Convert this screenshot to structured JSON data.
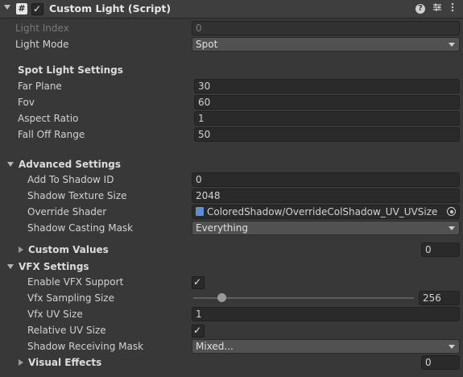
{
  "component": {
    "title": "Custom Light (Script)",
    "script_icon": "#",
    "enabled_check": "✓",
    "icons": [
      "help-icon",
      "presets-icon",
      "kebab-menu-icon"
    ]
  },
  "fields": {
    "light_index": {
      "label": "Light Index",
      "value": "0"
    },
    "light_mode": {
      "label": "Light Mode",
      "value": "Spot"
    }
  },
  "spot": {
    "header": "Spot Light Settings",
    "far_plane": {
      "label": "Far Plane",
      "value": "30"
    },
    "fov": {
      "label": "Fov",
      "value": "60"
    },
    "aspect_ratio": {
      "label": "Aspect Ratio",
      "value": "1"
    },
    "fall_off_range": {
      "label": "Fall Off Range",
      "value": "50"
    }
  },
  "advanced": {
    "header": "Advanced Settings",
    "add_to_shadow_id": {
      "label": "Add To Shadow ID",
      "value": "0"
    },
    "shadow_texture_size": {
      "label": "Shadow Texture Size",
      "value": "2048"
    },
    "override_shader": {
      "label": "Override Shader",
      "value": "ColoredShadow/OverrideColShadow_UV_UVSize"
    },
    "shadow_casting_mask": {
      "label": "Shadow Casting Mask",
      "value": "Everything"
    }
  },
  "custom_values": {
    "label": "Custom Values",
    "count": "0"
  },
  "vfx": {
    "header": "VFX Settings",
    "enable_vfx_support": {
      "label": "Enable VFX Support",
      "checked": true
    },
    "vfx_sampling_size": {
      "label": "Vfx Sampling Size",
      "value": "256",
      "slider_fraction": 0.13
    },
    "vfx_uv_size": {
      "label": "Vfx UV Size",
      "value": "1"
    },
    "relative_uv_size": {
      "label": "Relative UV Size",
      "checked": true
    },
    "shadow_receiving_mask": {
      "label": "Shadow Receiving Mask",
      "value": "Mixed..."
    }
  },
  "visual_effects": {
    "label": "Visual Effects",
    "count": "0"
  },
  "checkmark": "✓"
}
